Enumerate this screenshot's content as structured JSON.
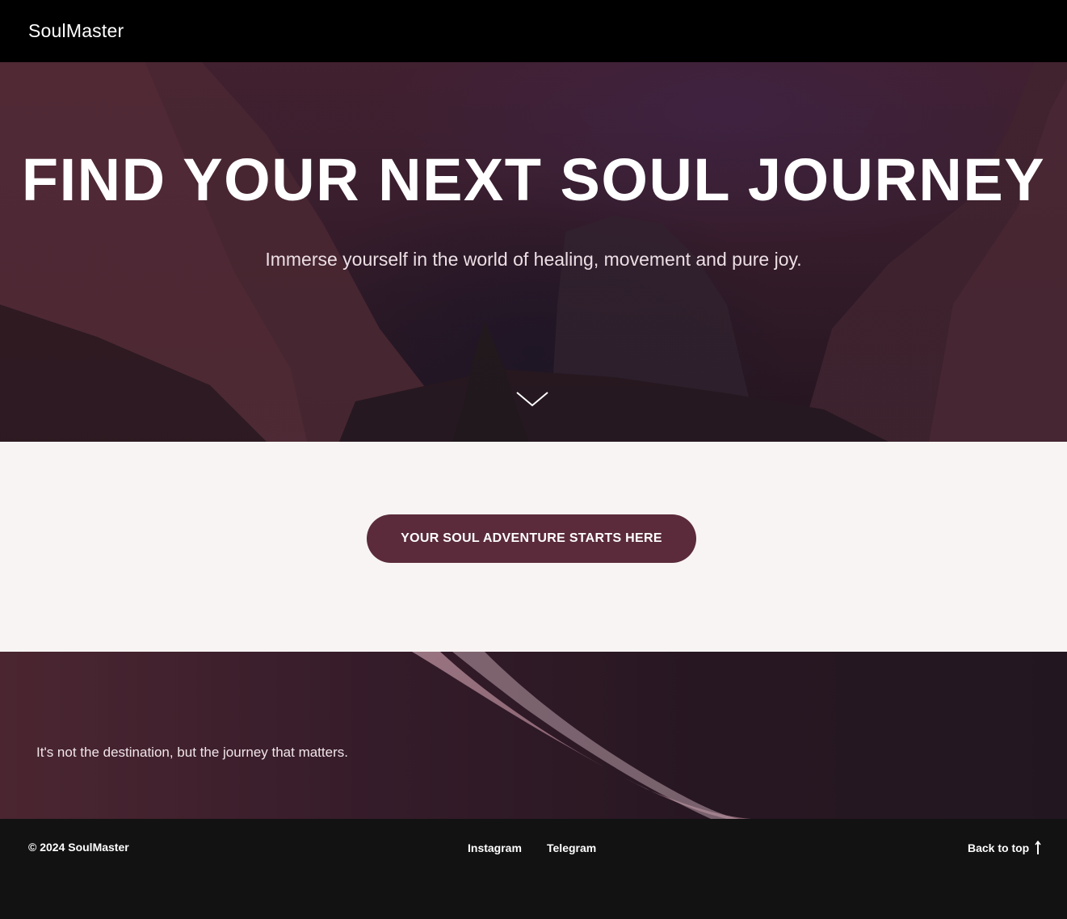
{
  "header": {
    "brand": "SoulMaster"
  },
  "hero": {
    "title": "FIND YOUR NEXT SOUL JOURNEY",
    "subtitle": "Immerse yourself in the world of healing, movement and pure joy.",
    "scroll_icon": "chevron-down-icon"
  },
  "cta": {
    "label": "YOUR SOUL ADVENTURE STARTS HERE"
  },
  "quote": {
    "text": "It's not the destination, but the journey that matters."
  },
  "footer": {
    "copyright": "© 2024 SoulMaster",
    "links": [
      "Instagram",
      "Telegram"
    ],
    "back_to_top": "Back to top",
    "back_to_top_icon": "arrow-up-icon"
  },
  "colors": {
    "header_bg": "#000000",
    "cta_bg": "#5b2b3b",
    "section_bg": "#f8f4f3",
    "footer_bg": "#121212"
  }
}
